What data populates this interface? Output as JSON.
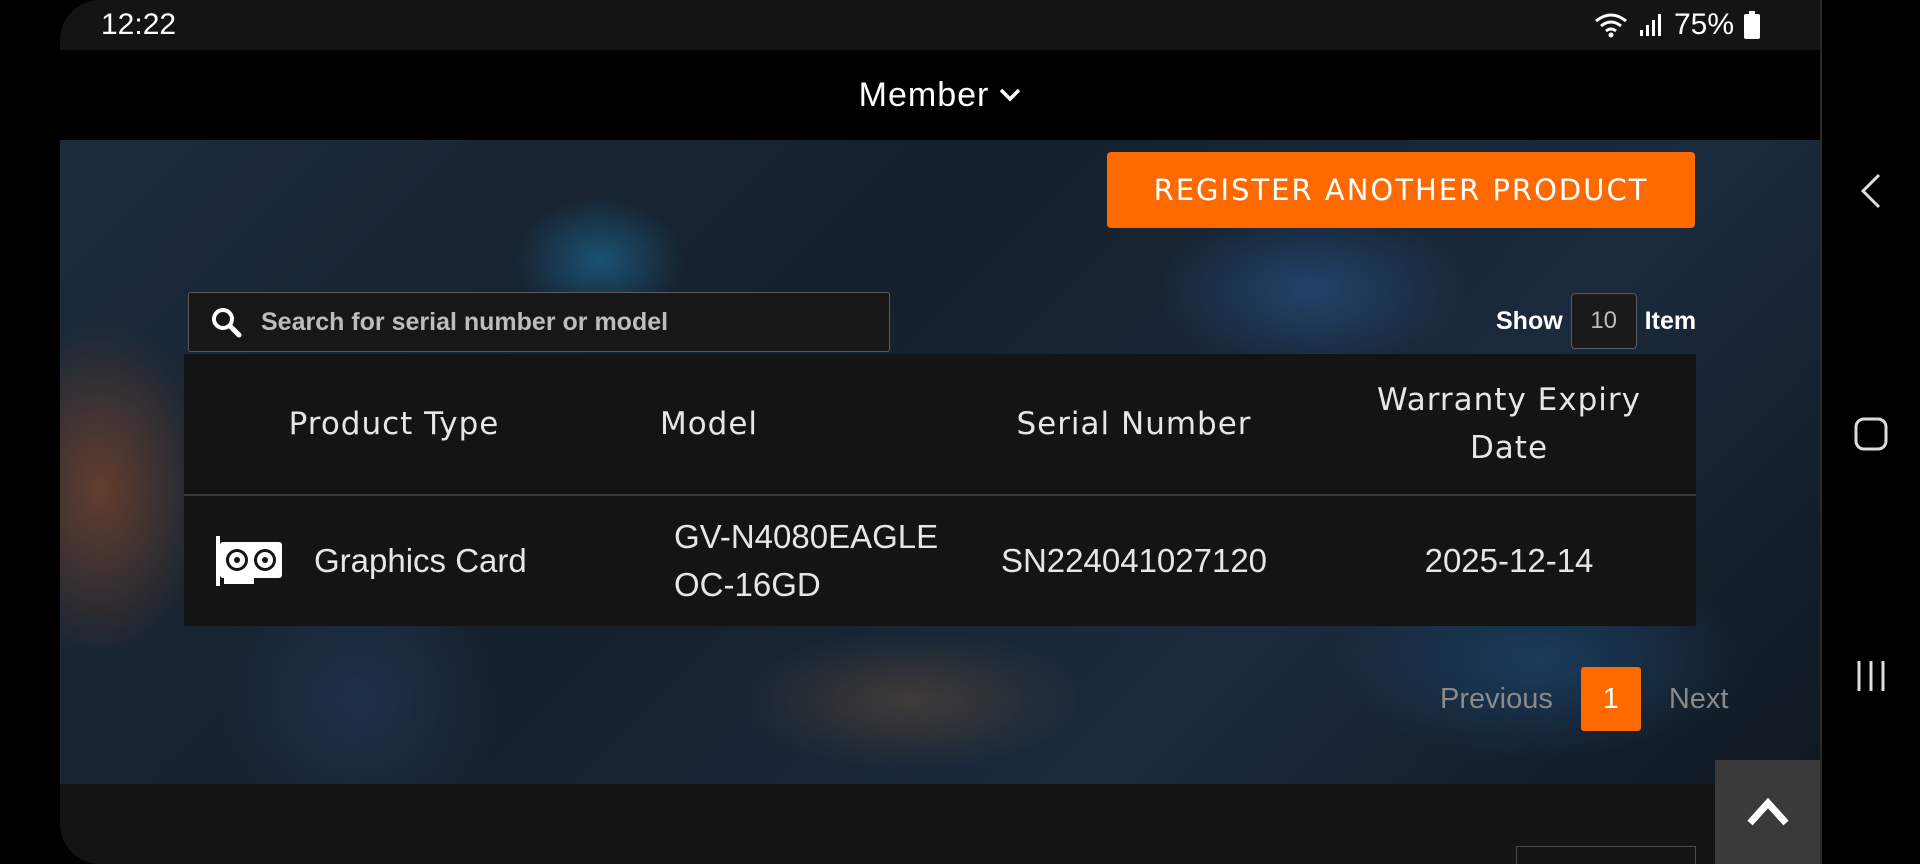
{
  "status_bar": {
    "time": "12:22",
    "battery": "75%"
  },
  "nav": {
    "member_label": "Member"
  },
  "actions": {
    "register_label": "REGISTER ANOTHER PRODUCT"
  },
  "search": {
    "placeholder": "Search for serial number or model"
  },
  "show": {
    "show_label": "Show",
    "count": "10",
    "item_label": "Item"
  },
  "table": {
    "headers": [
      "Product Type",
      "Model",
      "Serial Number",
      "Warranty Expiry Date"
    ],
    "rows": [
      {
        "product_type": "Graphics Card",
        "model": "GV-N4080EAGLE OC-16GD",
        "serial": "SN224041027120",
        "warranty": "2025-12-14"
      }
    ]
  },
  "pagination": {
    "previous": "Previous",
    "current": "1",
    "next": "Next"
  },
  "colors": {
    "accent": "#ff6a00",
    "background": "#141414"
  },
  "icons": [
    "wifi-icon",
    "signal-icon",
    "battery-icon",
    "chevron-down-icon",
    "search-icon",
    "graphics-card-icon",
    "chevron-up-icon",
    "back-icon",
    "home-icon",
    "recents-icon"
  ]
}
